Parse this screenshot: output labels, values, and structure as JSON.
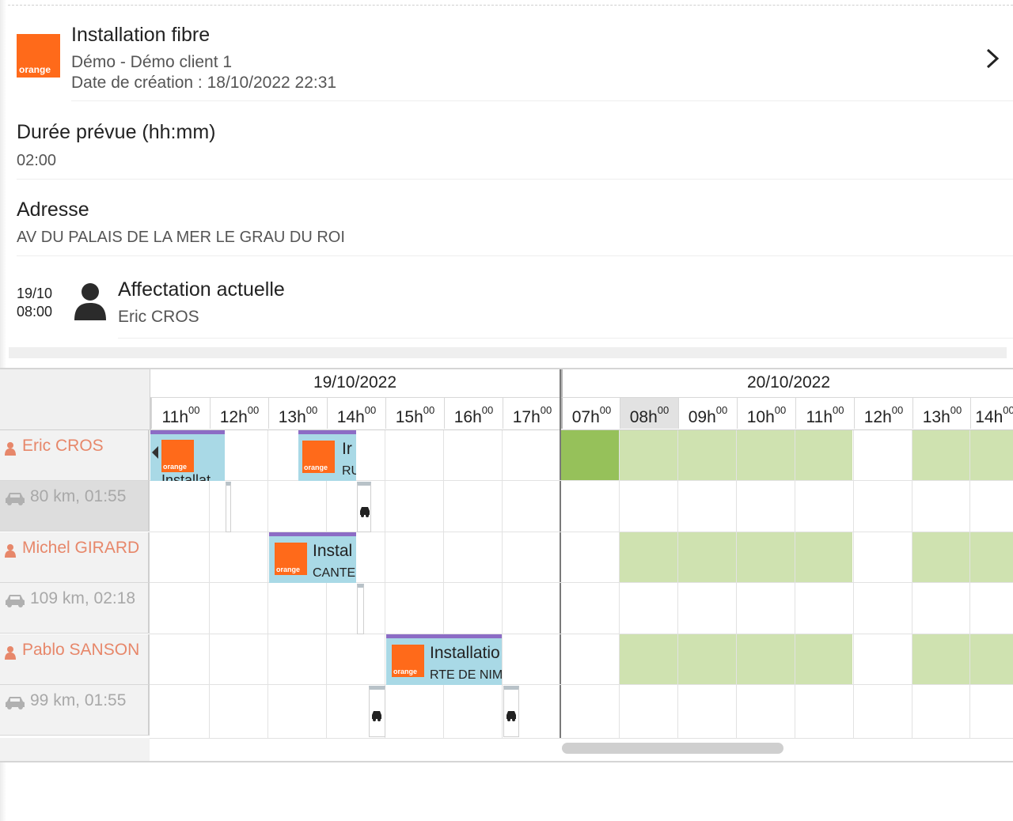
{
  "job": {
    "logo_text": "orange",
    "title": "Installation fibre",
    "client": "Démo - Démo client 1",
    "created": "Date de création : 18/10/2022 22:31"
  },
  "duration": {
    "label": "Durée prévue (hh:mm)",
    "value": "02:00"
  },
  "address": {
    "label": "Adresse",
    "value": "AV DU PALAIS DE LA MER LE GRAU DU ROI"
  },
  "assignment": {
    "date": "19/10",
    "time": "08:00",
    "title": "Affectation actuelle",
    "name": "Eric CROS"
  },
  "planning": {
    "dates": [
      "19/10/2022",
      "20/10/2022"
    ],
    "hours": [
      "11h",
      "12h",
      "13h",
      "14h",
      "15h",
      "16h",
      "17h",
      "07h",
      "08h",
      "09h",
      "10h",
      "11h",
      "12h",
      "13h",
      "14h"
    ],
    "hour_suffix": "00",
    "resources": [
      {
        "name": "Eric CROS",
        "travel": "80 km, 01:55"
      },
      {
        "name": "Michel GIRARD",
        "travel": "109 km, 02:18"
      },
      {
        "name": "Pablo SANSON",
        "travel": "99 km, 01:55"
      }
    ],
    "tasks": [
      {
        "name": "Installat",
        "addr": "",
        "logo": "orange"
      },
      {
        "name": "Ir",
        "addr": "RU",
        "logo": "orange"
      },
      {
        "name": "Instal",
        "addr": "CANTE",
        "logo": "orange"
      },
      {
        "name": "Installatio",
        "addr": "RTE DE NIM",
        "logo": "orange"
      }
    ],
    "colors": {
      "available": "#cfe2b0",
      "current": "#96c15a",
      "task": "#a9d9e6",
      "task_top": "#8c6cc5"
    }
  }
}
